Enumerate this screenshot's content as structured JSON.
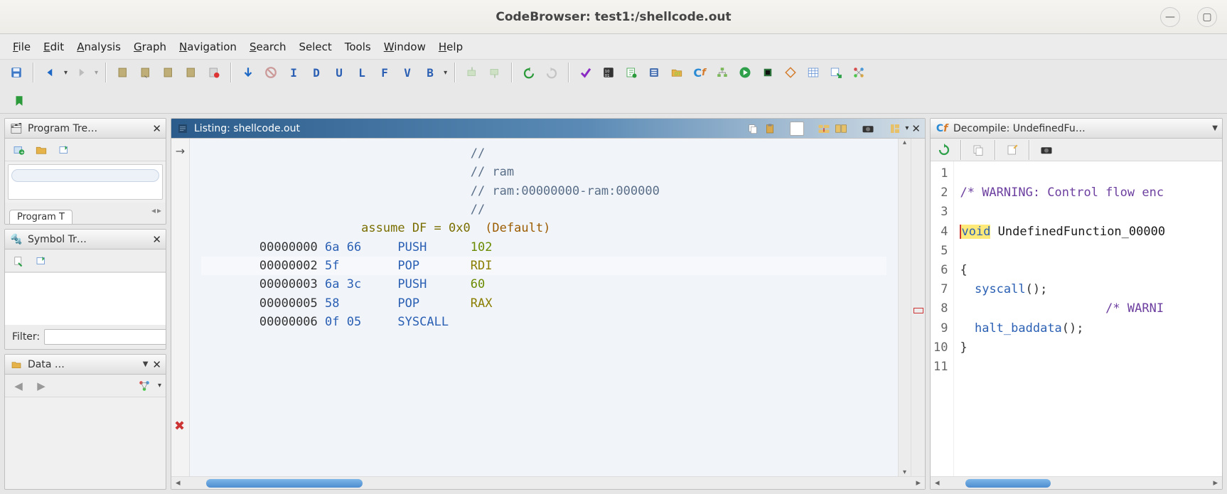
{
  "window": {
    "title": "CodeBrowser: test1:/shellcode.out"
  },
  "menu": {
    "file": "File",
    "edit": "Edit",
    "analysis": "Analysis",
    "graph": "Graph",
    "navigation": "Navigation",
    "search": "Search",
    "select": "Select",
    "tools": "Tools",
    "window": "Window",
    "help": "Help"
  },
  "toolbar_letters": [
    "I",
    "D",
    "U",
    "L",
    "F",
    "V",
    "B"
  ],
  "panels": {
    "program_tree": {
      "title": "Program Tre…",
      "tab": "Program T"
    },
    "symbol_tree": {
      "title": "Symbol Tr…",
      "filter_label": "Filter:"
    },
    "data_type": {
      "title": "Data …"
    },
    "listing": {
      "title": "Listing:  shellcode.out",
      "comment_lines": [
        "//",
        "// ram",
        "// ram:00000000-ram:000000",
        "//"
      ],
      "assume": "assume DF = 0x0",
      "assume_default": "(Default)",
      "rows": [
        {
          "addr": "00000000",
          "bytes": "6a 66",
          "mnemonic": "PUSH",
          "operand": "102",
          "opclass": "opg"
        },
        {
          "addr": "00000002",
          "bytes": "5f",
          "mnemonic": "POP",
          "operand": "RDI",
          "opclass": "opy"
        },
        {
          "addr": "00000003",
          "bytes": "6a 3c",
          "mnemonic": "PUSH",
          "operand": "60",
          "opclass": "opg"
        },
        {
          "addr": "00000005",
          "bytes": "58",
          "mnemonic": "POP",
          "operand": "RAX",
          "opclass": "opy"
        },
        {
          "addr": "00000006",
          "bytes": "0f 05",
          "mnemonic": "SYSCALL",
          "operand": "",
          "opclass": ""
        }
      ]
    },
    "decompile": {
      "title": "Decompile: UndefinedFu…",
      "lines": [
        "",
        "/* WARNING: Control flow enc",
        "",
        "void UndefinedFunction_00000",
        "",
        "{",
        "  syscall();",
        "                    /* WARNI",
        "  halt_baddata();",
        "}",
        ""
      ],
      "gutter": [
        " 1",
        " 2",
        " 3",
        " 4",
        " 5",
        " 6",
        " 7",
        " 8",
        " 9",
        "10",
        "11"
      ]
    }
  }
}
